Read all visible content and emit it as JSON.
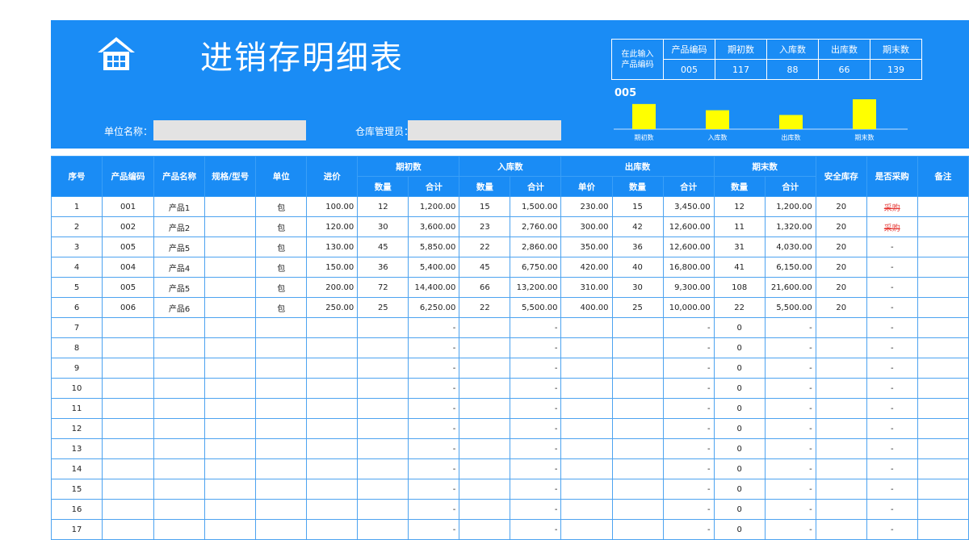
{
  "header": {
    "title": "进销存明细表",
    "unit_label": "单位名称：",
    "unit_value": "",
    "manager_label": "仓库管理员：",
    "manager_value": ""
  },
  "summary": {
    "hint_line1": "在此输入",
    "hint_line2": "产品编码",
    "headers": [
      "产品编码",
      "期初数",
      "入库数",
      "出库数",
      "期末数"
    ],
    "values": [
      "005",
      "117",
      "88",
      "66",
      "139"
    ]
  },
  "chart_data": {
    "type": "bar",
    "title": "005",
    "categories": [
      "期初数",
      "入库数",
      "出库数",
      "期末数"
    ],
    "values": [
      117,
      88,
      66,
      139
    ],
    "color": "#ffff00",
    "ylim": [
      0,
      139
    ]
  },
  "table": {
    "headers": {
      "seq": "序号",
      "code": "产品编码",
      "name": "产品名称",
      "spec": "规格/型号",
      "unit": "单位",
      "price": "进价",
      "opening": "期初数",
      "inbound": "入库数",
      "outbound": "出库数",
      "closing": "期末数",
      "safety": "安全库存",
      "purchase": "是否采购",
      "remark": "备注",
      "qty": "数量",
      "total": "合计",
      "unit_price": "单价"
    },
    "rows": [
      [
        "1",
        "001",
        "产品1",
        "",
        "包",
        "100.00",
        "12",
        "1,200.00",
        "15",
        "1,500.00",
        "230.00",
        "15",
        "3,450.00",
        "12",
        "1,200.00",
        "20",
        "采购",
        ""
      ],
      [
        "2",
        "002",
        "产品2",
        "",
        "包",
        "120.00",
        "30",
        "3,600.00",
        "23",
        "2,760.00",
        "300.00",
        "42",
        "12,600.00",
        "11",
        "1,320.00",
        "20",
        "采购",
        ""
      ],
      [
        "3",
        "005",
        "产品5",
        "",
        "包",
        "130.00",
        "45",
        "5,850.00",
        "22",
        "2,860.00",
        "350.00",
        "36",
        "12,600.00",
        "31",
        "4,030.00",
        "20",
        "-",
        ""
      ],
      [
        "4",
        "004",
        "产品4",
        "",
        "包",
        "150.00",
        "36",
        "5,400.00",
        "45",
        "6,750.00",
        "420.00",
        "40",
        "16,800.00",
        "41",
        "6,150.00",
        "20",
        "-",
        ""
      ],
      [
        "5",
        "005",
        "产品5",
        "",
        "包",
        "200.00",
        "72",
        "14,400.00",
        "66",
        "13,200.00",
        "310.00",
        "30",
        "9,300.00",
        "108",
        "21,600.00",
        "20",
        "-",
        ""
      ],
      [
        "6",
        "006",
        "产品6",
        "",
        "包",
        "250.00",
        "25",
        "6,250.00",
        "22",
        "5,500.00",
        "400.00",
        "25",
        "10,000.00",
        "22",
        "5,500.00",
        "20",
        "-",
        ""
      ],
      [
        "7",
        "",
        "",
        "",
        "",
        "",
        "",
        "-",
        "",
        "-",
        "",
        "",
        "-",
        "0",
        "-",
        "",
        "-",
        ""
      ],
      [
        "8",
        "",
        "",
        "",
        "",
        "",
        "",
        "-",
        "",
        "-",
        "",
        "",
        "-",
        "0",
        "-",
        "",
        "-",
        ""
      ],
      [
        "9",
        "",
        "",
        "",
        "",
        "",
        "",
        "-",
        "",
        "-",
        "",
        "",
        "-",
        "0",
        "-",
        "",
        "-",
        ""
      ],
      [
        "10",
        "",
        "",
        "",
        "",
        "",
        "",
        "-",
        "",
        "-",
        "",
        "",
        "-",
        "0",
        "-",
        "",
        "-",
        ""
      ],
      [
        "11",
        "",
        "",
        "",
        "",
        "",
        "",
        "-",
        "",
        "-",
        "",
        "",
        "-",
        "0",
        "-",
        "",
        "-",
        ""
      ],
      [
        "12",
        "",
        "",
        "",
        "",
        "",
        "",
        "-",
        "",
        "-",
        "",
        "",
        "-",
        "0",
        "-",
        "",
        "-",
        ""
      ],
      [
        "13",
        "",
        "",
        "",
        "",
        "",
        "",
        "-",
        "",
        "-",
        "",
        "",
        "-",
        "0",
        "-",
        "",
        "-",
        ""
      ],
      [
        "14",
        "",
        "",
        "",
        "",
        "",
        "",
        "-",
        "",
        "-",
        "",
        "",
        "-",
        "0",
        "-",
        "",
        "-",
        ""
      ],
      [
        "15",
        "",
        "",
        "",
        "",
        "",
        "",
        "-",
        "",
        "-",
        "",
        "",
        "-",
        "0",
        "-",
        "",
        "-",
        ""
      ],
      [
        "16",
        "",
        "",
        "",
        "",
        "",
        "",
        "-",
        "",
        "-",
        "",
        "",
        "-",
        "0",
        "-",
        "",
        "-",
        ""
      ],
      [
        "17",
        "",
        "",
        "",
        "",
        "",
        "",
        "-",
        "",
        "-",
        "",
        "",
        "-",
        "0",
        "-",
        "",
        "-",
        ""
      ]
    ]
  }
}
